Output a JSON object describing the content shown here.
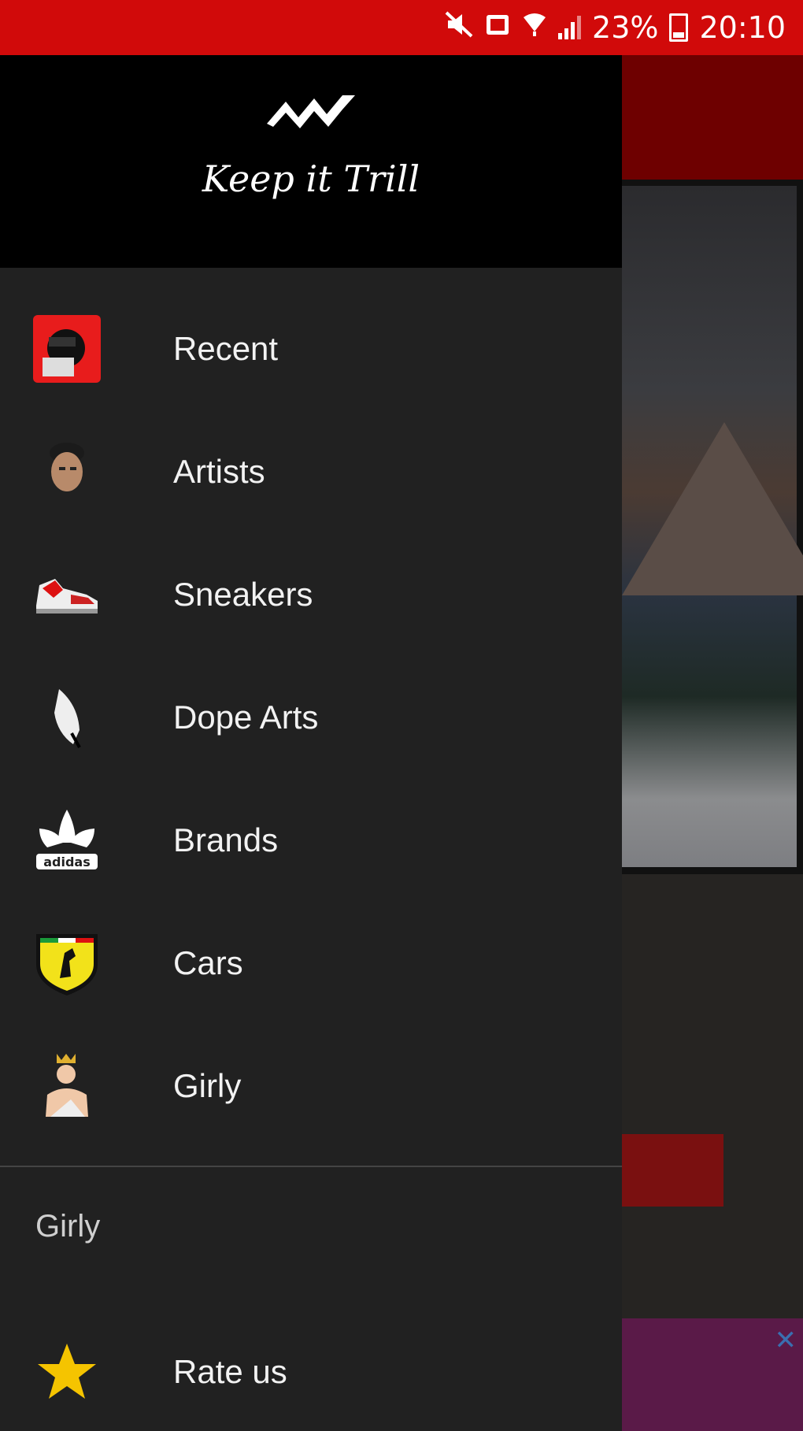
{
  "status_bar": {
    "battery": "23%",
    "time": "20:10"
  },
  "drawer": {
    "header_title": "Keep it Trill",
    "menu_items": [
      {
        "label": "Recent",
        "icon": "recent-avatar-icon"
      },
      {
        "label": "Artists",
        "icon": "artist-avatar-icon"
      },
      {
        "label": "Sneakers",
        "icon": "sneaker-icon"
      },
      {
        "label": "Dope Arts",
        "icon": "feather-art-icon"
      },
      {
        "label": "Brands",
        "icon": "adidas-logo-icon"
      },
      {
        "label": "Cars",
        "icon": "ferrari-shield-icon"
      },
      {
        "label": "Girly",
        "icon": "girly-icon"
      }
    ],
    "section_label": "Girly",
    "rate_item": {
      "label": "Rate us",
      "icon": "star-icon"
    }
  },
  "colors": {
    "status_bar": "#d10a0a",
    "drawer_bg": "#212121",
    "header_bg": "#000000",
    "star": "#f5c400"
  }
}
